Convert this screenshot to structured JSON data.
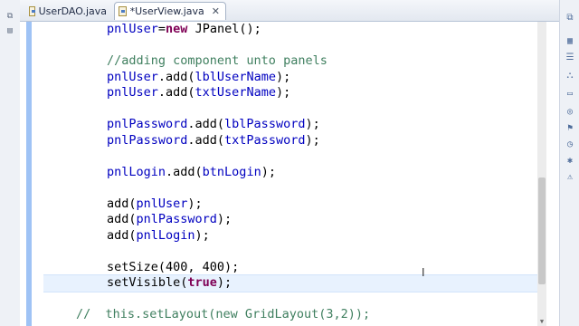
{
  "tabs": [
    {
      "label": "UserDAO.java",
      "active": false
    },
    {
      "label": "*UserView.java",
      "active": true,
      "close": "✕"
    }
  ],
  "left_rail": {
    "icons": [
      "restore-icon",
      "pin-icon"
    ]
  },
  "right_rail": {
    "icons": [
      "minimize-icon",
      "outline-icon",
      "task-icon",
      "hierarchy-icon",
      "console-icon",
      "search-icon",
      "bookmarks-icon",
      "history-icon",
      "debug-icon",
      "problems-icon"
    ]
  },
  "editor": {
    "lines": [
      {
        "tokens": [
          {
            "t": "pnlUser",
            "c": "fld"
          },
          {
            "t": "=",
            "c": ""
          },
          {
            "t": "new",
            "c": "kw"
          },
          {
            "t": " JPanel();",
            "c": ""
          }
        ]
      },
      {
        "tokens": []
      },
      {
        "tokens": [
          {
            "t": "//adding component unto panels",
            "c": "cmt"
          }
        ]
      },
      {
        "tokens": [
          {
            "t": "pnlUser",
            "c": "fld"
          },
          {
            "t": ".add(",
            "c": ""
          },
          {
            "t": "lblUserName",
            "c": "fld"
          },
          {
            "t": ");",
            "c": ""
          }
        ]
      },
      {
        "tokens": [
          {
            "t": "pnlUser",
            "c": "fld"
          },
          {
            "t": ".add(",
            "c": ""
          },
          {
            "t": "txtUserName",
            "c": "fld"
          },
          {
            "t": ");",
            "c": ""
          }
        ]
      },
      {
        "tokens": []
      },
      {
        "tokens": [
          {
            "t": "pnlPassword",
            "c": "fld"
          },
          {
            "t": ".add(",
            "c": ""
          },
          {
            "t": "lblPassword",
            "c": "fld"
          },
          {
            "t": ");",
            "c": ""
          }
        ]
      },
      {
        "tokens": [
          {
            "t": "pnlPassword",
            "c": "fld"
          },
          {
            "t": ".add(",
            "c": ""
          },
          {
            "t": "txtPassword",
            "c": "fld"
          },
          {
            "t": ");",
            "c": ""
          }
        ]
      },
      {
        "tokens": []
      },
      {
        "tokens": [
          {
            "t": "pnlLogin",
            "c": "fld"
          },
          {
            "t": ".add(",
            "c": ""
          },
          {
            "t": "btnLogin",
            "c": "fld"
          },
          {
            "t": ");",
            "c": ""
          }
        ]
      },
      {
        "tokens": []
      },
      {
        "tokens": [
          {
            "t": "add(",
            "c": ""
          },
          {
            "t": "pnlUser",
            "c": "fld"
          },
          {
            "t": ");",
            "c": ""
          }
        ]
      },
      {
        "tokens": [
          {
            "t": "add(",
            "c": ""
          },
          {
            "t": "pnlPassword",
            "c": "fld"
          },
          {
            "t": ");",
            "c": ""
          }
        ]
      },
      {
        "tokens": [
          {
            "t": "add(",
            "c": ""
          },
          {
            "t": "pnlLogin",
            "c": "fld"
          },
          {
            "t": ");",
            "c": ""
          }
        ]
      },
      {
        "tokens": []
      },
      {
        "tokens": [
          {
            "t": "setSize(400, 400);",
            "c": ""
          }
        ]
      },
      {
        "tokens": [
          {
            "t": "setVisible(",
            "c": ""
          },
          {
            "t": "true",
            "c": "kw"
          },
          {
            "t": ");",
            "c": ""
          }
        ]
      },
      {
        "tokens": []
      },
      {
        "tokens": [
          {
            "t": "//  this.setLayout(new GridLayout(3,2));",
            "c": "cmt"
          }
        ]
      }
    ]
  },
  "colors": {
    "field": "#0000c0",
    "keyword": "#7f0055",
    "comment": "#3f7f5f",
    "current_line": "#e8f2fe",
    "change_bar": "#9fc3f5"
  }
}
